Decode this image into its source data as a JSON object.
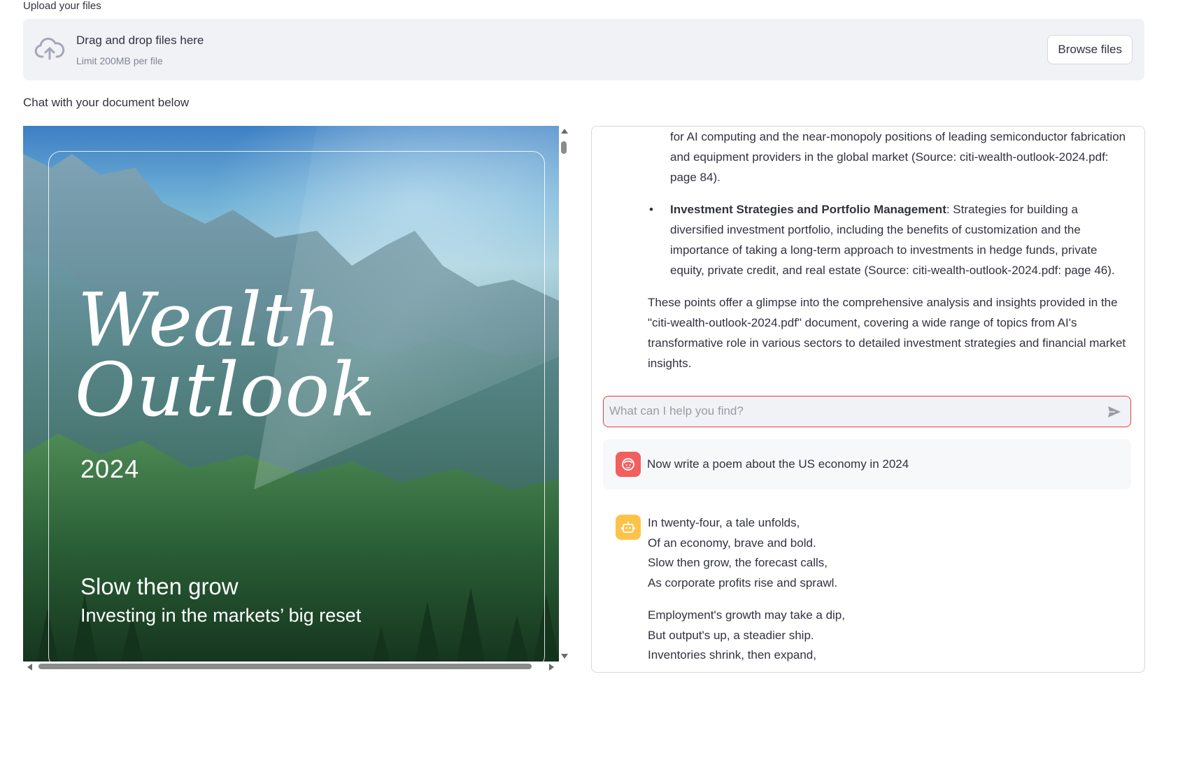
{
  "upload": {
    "label": "Upload your files",
    "dropzone_title": "Drag and drop files here",
    "dropzone_limit": "Limit 200MB per file",
    "browse_label": "Browse files"
  },
  "chat_caption": "Chat with your document below",
  "pdf_cover": {
    "title_line1": "Wealth",
    "title_line2": "Outlook",
    "year": "2024",
    "headline": "Slow then grow",
    "subheadline": "Investing in the markets’ big reset"
  },
  "chat": {
    "prev_bullet_text": "for AI computing and the near-monopoly positions of leading semiconductor fabrication and equipment providers in the global market (Source: citi-wealth-outlook-2024.pdf: page 84).",
    "bullet2_title": "Investment Strategies and Portfolio Management",
    "bullet2_text": ": Strategies for building a diversified investment portfolio, including the benefits of customization and the importance of taking a long-term approach to investments in hedge funds, private equity, private credit, and real estate (Source: citi-wealth-outlook-2024.pdf: page 46).",
    "summary": "These points offer a glimpse into the comprehensive analysis and insights provided in the \"citi-wealth-outlook-2024.pdf\" document, covering a wide range of topics from AI's transformative role in various sectors to detailed investment strategies and financial market insights.",
    "input_placeholder": "What can I help you find?",
    "user_message": "Now write a poem about the US economy in 2024",
    "poem": {
      "stanza1": [
        "In twenty-four, a tale unfolds,",
        "Of an economy, brave and bold.",
        "Slow then grow, the forecast calls,",
        "As corporate profits rise and sprawl."
      ],
      "stanza2": [
        "Employment's growth may take a dip,",
        "But output's up, a steadier ship.",
        "Inventories shrink, then expand,"
      ]
    }
  },
  "icons": {
    "upload": "cloud-upload-icon",
    "send": "send-icon",
    "user_avatar": "user-face-icon",
    "bot_avatar": "robot-icon"
  },
  "colors": {
    "dropzone_bg": "#f0f2f6",
    "input_border_focus": "#f03c3c",
    "user_avatar": "#f0605e",
    "bot_avatar": "#fdc349",
    "text": "#31333f"
  }
}
